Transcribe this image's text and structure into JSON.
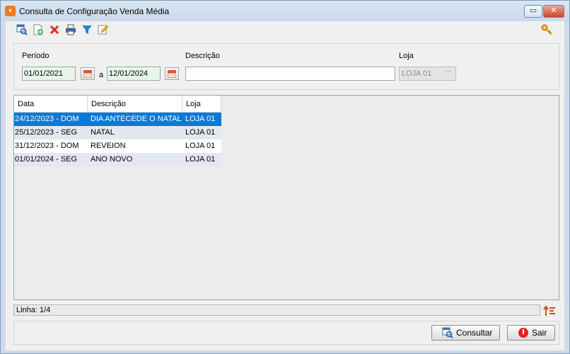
{
  "window": {
    "title": "Consulta de Configuração Venda Média",
    "maximize_glyph": "▭",
    "close_glyph": "✕"
  },
  "toolbar": {
    "icons": [
      "view-search-icon",
      "add-record-icon",
      "delete-icon",
      "print-icon",
      "filter-icon",
      "edit-pencil-icon",
      "key-icon"
    ]
  },
  "filters": {
    "periodo_label": "Período",
    "date_from": "01/01/2021",
    "date_sep": "a",
    "date_to": "12/01/2024",
    "descricao_label": "Descrição",
    "descricao_value": "",
    "loja_label": "Loja",
    "loja_value": "LOJA 01",
    "loja_arrow": "﹀"
  },
  "grid": {
    "columns": [
      "Data",
      "Descrição",
      "Loja"
    ],
    "rows": [
      {
        "data": "24/12/2023 - DOM",
        "descricao": "DIA ANTECEDE O NATAL",
        "loja": "LOJA 01"
      },
      {
        "data": "25/12/2023 - SEG",
        "descricao": "NATAL",
        "loja": "LOJA 01"
      },
      {
        "data": "31/12/2023 - DOM",
        "descricao": "REVEION",
        "loja": "LOJA 01"
      },
      {
        "data": "01/01/2024 - SEG",
        "descricao": "ANO NOVO",
        "loja": "LOJA 01"
      }
    ]
  },
  "status": {
    "linha": "Linha: 1/4"
  },
  "buttons": {
    "consultar": "Consultar",
    "sair": "Sair"
  },
  "colors": {
    "selection": "#0a7ad8",
    "alt_row": "#e3e8f0",
    "title_icon": "#f07b1c"
  }
}
